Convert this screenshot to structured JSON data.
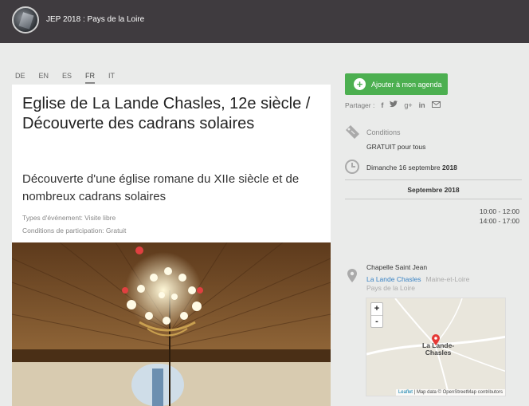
{
  "header": {
    "site_title": "JEP 2018 : Pays de la Loire"
  },
  "languages": [
    {
      "code": "DE"
    },
    {
      "code": "EN"
    },
    {
      "code": "ES"
    },
    {
      "code": "FR",
      "active": true
    },
    {
      "code": "IT"
    }
  ],
  "event": {
    "title": "Eglise de La Lande Chasles, 12e siècle / Découverte des cadrans solaires",
    "subtitle": "Découverte d'une église romane du XIIe siècle et de nombreux cadrans solaires",
    "types": "Types d'événement: Visite libre",
    "conditions_participation": "Conditions de participation: Gratuit"
  },
  "sidebar": {
    "agenda_button": "Ajouter à mon agenda",
    "share_label": "Partager :",
    "share_icons": [
      "facebook-icon",
      "twitter-icon",
      "google-plus-icon",
      "linkedin-icon",
      "email-icon"
    ],
    "conditions_label": "Conditions",
    "conditions_value": "GRATUIT pour tous",
    "date_prefix": "Dimanche 16 septembre",
    "date_year": "2018",
    "month_header": "Septembre 2018",
    "times": [
      "10:00 - 12:00",
      "14:00 - 17:00"
    ],
    "place": {
      "name": "Chapelle Saint Jean",
      "town": "La Lande Chasles",
      "department": "Maine-et-Loire",
      "region": "Pays de la Loire"
    },
    "map": {
      "zoom_in": "+",
      "zoom_out": "-",
      "label_line1": "La Lande-",
      "label_line2": "Chasles",
      "attribution_leaflet": "Leaflet",
      "attribution_rest": " | Map data © OpenStreetMap contributors"
    }
  },
  "colors": {
    "header_bg": "#3f3b3f",
    "accent_green": "#4caf50",
    "link_blue": "#3a83c4",
    "marker_red": "#e53935"
  }
}
